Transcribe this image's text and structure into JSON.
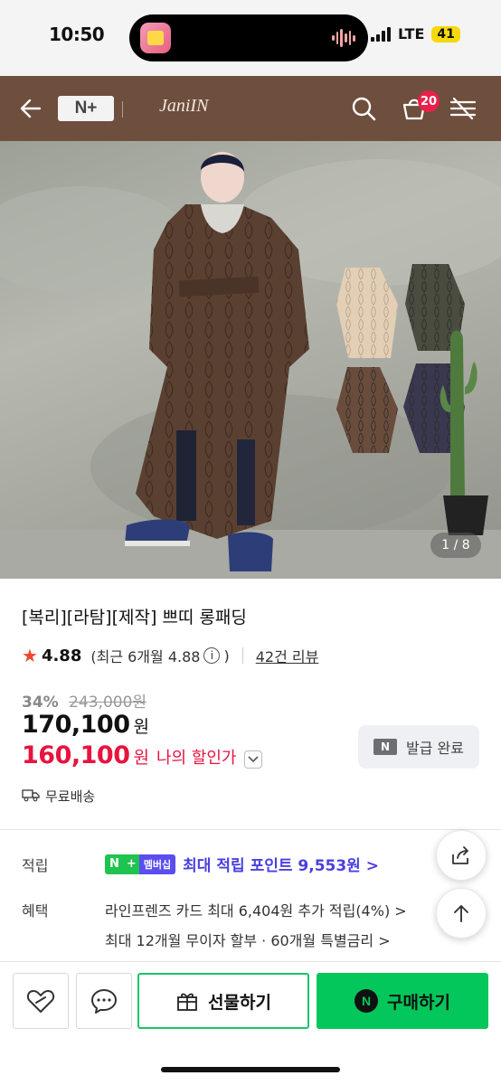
{
  "status_bar": {
    "time": "10:50",
    "network": "LTE",
    "battery": "41"
  },
  "header": {
    "nplus_label": "N+",
    "brand": "JaniIN",
    "cart_count": "20"
  },
  "product": {
    "image_counter": "1 / 8",
    "title": "[복리][라탐][제작] 쁘띠 롱패딩",
    "rating": "4.88",
    "recent_rating_label": "(최근 6개월 4.88",
    "recent_rating_close": ")",
    "review_count": "42건 리뷰",
    "discount_rate": "34%",
    "original_price": "243,000원",
    "price": "170,100",
    "price_unit": "원",
    "my_price": "160,100",
    "my_price_unit": "원",
    "my_price_label": "나의 할인가",
    "coupon_label": "발급 완료",
    "shipping": "무료배송"
  },
  "benefits": {
    "points_label": "적립",
    "membership_badge": "멤버십",
    "points_text": "최대 적립 포인트 9,553원 >",
    "benefit_label": "혜택",
    "benefit_line1": "라인프렌즈 카드 최대 6,404원 추가 적립(4%) >",
    "benefit_line2": "최대 12개월 무이자 할부 · 60개월 특별금리 >"
  },
  "actions": {
    "gift_label": "선물하기",
    "buy_label": "구매하기"
  },
  "colors": {
    "header_bg": "#6e4e3c",
    "accent_red": "#e8133f",
    "naver_green": "#03c75a",
    "membership_purple": "#5b4df0"
  }
}
